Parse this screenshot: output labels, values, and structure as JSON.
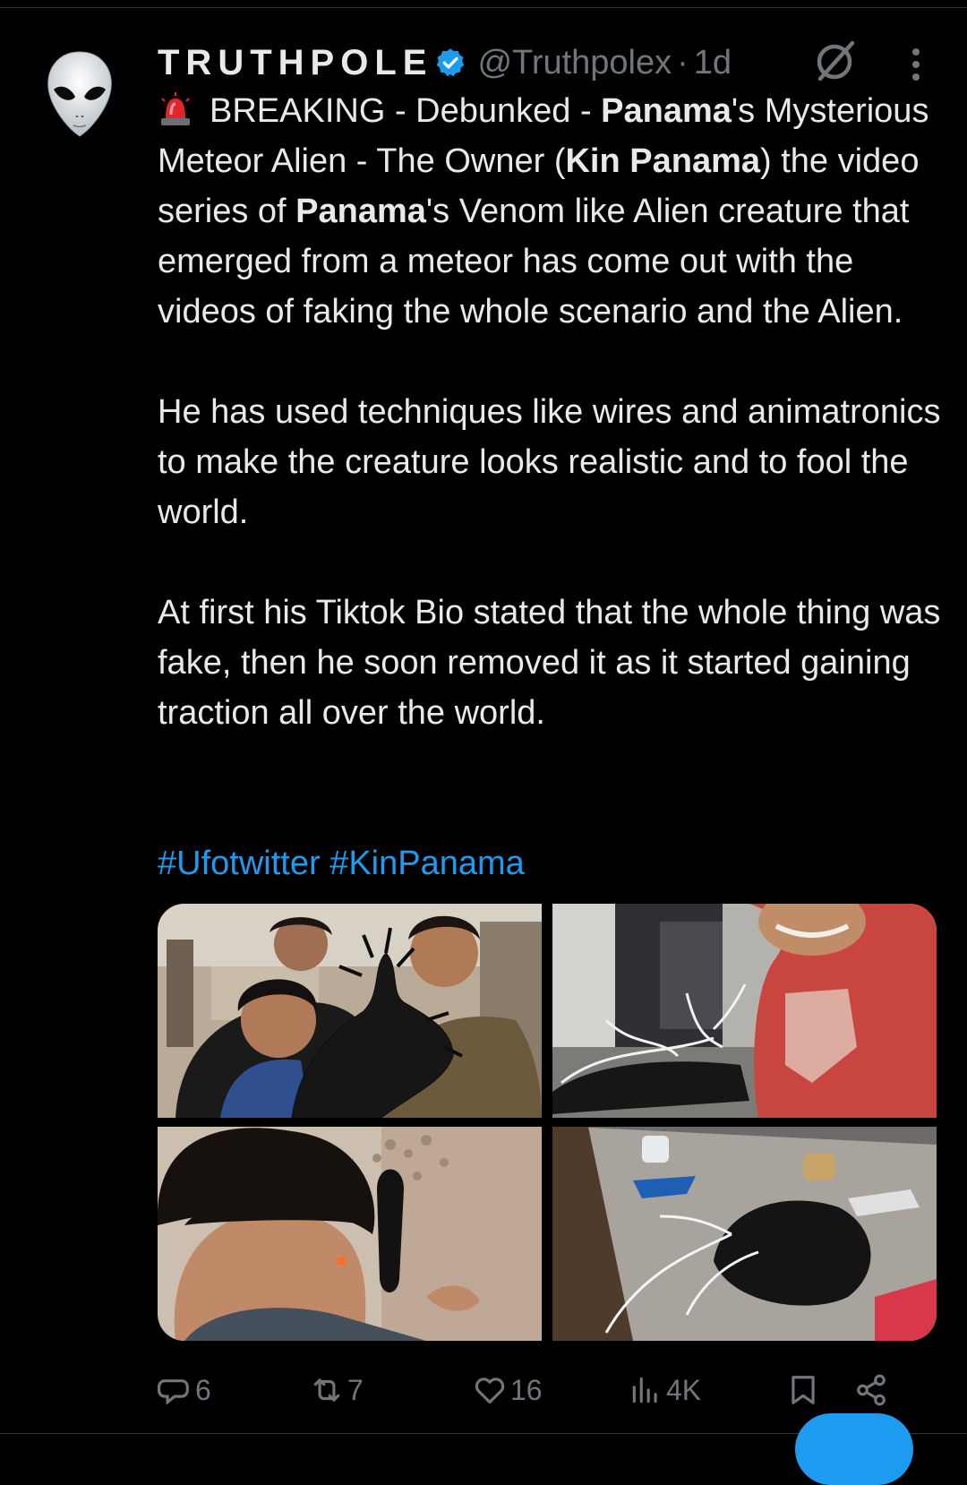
{
  "post": {
    "author_name": "TRUTHPOLE",
    "handle": "@Truthpolex",
    "separator": "·",
    "age": "1d",
    "body": {
      "p1": {
        "t1": "BREAKING - Debunked - ",
        "b1": "Panama",
        "t2": "'s Mysterious Meteor Alien - The Owner (",
        "b2": "Kin Panama",
        "t3": ")  the video series of ",
        "b3": "Panama",
        "t4": "'s Venom like Alien creature that emerged from a meteor has come out with the videos of faking the whole scenario and the Alien."
      },
      "p2": "He has used techniques like wires and animatronics to make the creature looks realistic and to fool the world.",
      "p3": "At first his Tiktok Bio stated that the whole thing was fake, then he soon removed it as it started gaining traction all over the world."
    },
    "hashtags": [
      "#Ufotwitter",
      "#KinPanama"
    ],
    "media_count": 4
  },
  "actions": {
    "replies": "6",
    "reposts": "7",
    "likes": "16",
    "views": "4K"
  },
  "icons": {
    "avatar": "alien-avatar",
    "verified": "verified-badge-icon",
    "grok": "grok-icon",
    "more": "more-icon",
    "siren": "siren-emoji",
    "reply": "reply-icon",
    "repost": "repost-icon",
    "like": "heart-icon",
    "views": "views-icon",
    "bookmark": "bookmark-icon",
    "share": "share-icon"
  },
  "colors": {
    "background": "#000000",
    "text": "#e7e9ea",
    "secondary": "#71767b",
    "accent": "#1d9bf0"
  }
}
